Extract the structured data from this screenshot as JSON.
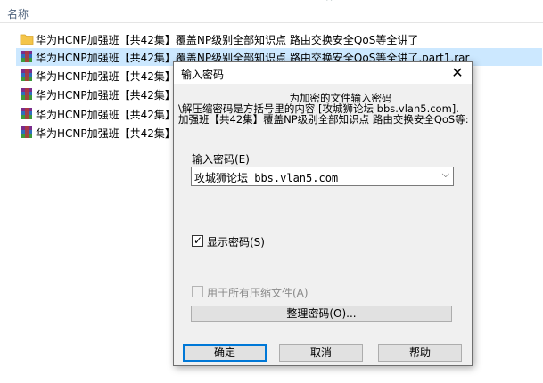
{
  "explorer": {
    "column_name": "名称",
    "files": [
      {
        "name": "华为HCNP加强班【共42集】覆盖NP级别全部知识点 路由交换安全QoS等全讲了",
        "icon": "folder-icon",
        "selected": false
      },
      {
        "name": "华为HCNP加强班【共42集】覆盖NP级别全部知识点 路由交换安全QoS等全讲了.part1.rar",
        "icon": "rar-archive-icon",
        "selected": true
      },
      {
        "name": "华为HCNP加强班【共42集】",
        "icon": "rar-archive-icon",
        "selected": false
      },
      {
        "name": "华为HCNP加强班【共42集】",
        "icon": "rar-archive-icon",
        "selected": false
      },
      {
        "name": "华为HCNP加强班【共42集】",
        "icon": "rar-archive-icon",
        "selected": false
      },
      {
        "name": "华为HCNP加强班【共42集】",
        "icon": "rar-archive-icon",
        "selected": false
      }
    ]
  },
  "dialog": {
    "title": "输入密码",
    "info_line1": "为加密的文件输入密码",
    "info_line2": "\\解压缩密码是方括号里的内容 [攻城狮论坛 bbs.vlan5.com].",
    "info_line3": "加强班【共42集】覆盖NP级别全部知识点 路由交换安全QoS等:",
    "password_label": "输入密码(E)",
    "password_value": "攻城狮论坛 bbs.vlan5.com",
    "show_password_label": "显示密码(S)",
    "show_password_checked": true,
    "use_all_label": "用于所有压缩文件(A)",
    "use_all_checked": false,
    "organize_button": "整理密码(O)...",
    "ok_button": "确定",
    "cancel_button": "取消",
    "help_button": "帮助"
  },
  "colors": {
    "selection": "#cce8ff",
    "dialog_bg": "#f0f0f0",
    "default_button_border": "#0078d7"
  }
}
